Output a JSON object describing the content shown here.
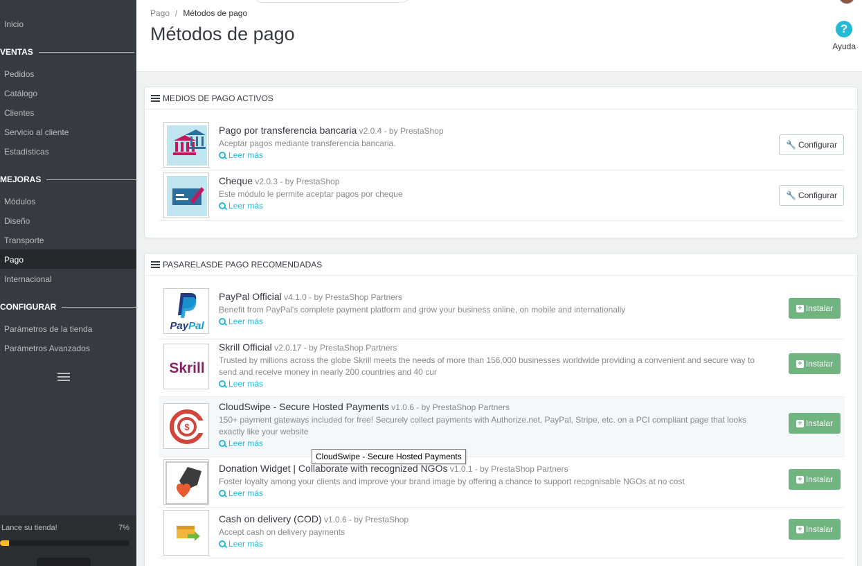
{
  "sidebar": {
    "items": {
      "inicio": "Inicio",
      "pedidos": "Pedidos",
      "catalogo": "Catálogo",
      "clientes": "Clientes",
      "servicio": "Servicio al cliente",
      "estadisticas": "Estadísticas",
      "modulos": "Módulos",
      "diseno": "Diseño",
      "transporte": "Transporte",
      "pago": "Pago",
      "internacional": "Internacional",
      "parametros_tienda": "Parámetros de la tienda",
      "parametros_avanzados": "Parámetros Avanzados"
    },
    "sections": {
      "ventas": "VENTAS",
      "mejoras": "MEJORAS",
      "configurar": "CONFIGURAR"
    },
    "launch": {
      "label": "Lance su tienda!",
      "percent_text": "7%",
      "progress": 0.07
    }
  },
  "header": {
    "breadcrumb": {
      "parent": "Pago",
      "separator": "/",
      "current": "Métodos de pago"
    },
    "title": "Métodos de pago",
    "help_label": "Ayuda",
    "help_icon": "?"
  },
  "active_panel": {
    "heading": "MEDIOS DE PAGO ACTIVOS",
    "modules": [
      {
        "name": "Pago por transferencia bancaria",
        "meta": "v2.0.4 - by PrestaShop",
        "desc": "Aceptar pagos mediante transferencia bancaria.",
        "more": "Leer más",
        "button": "Configurar"
      },
      {
        "name": "Cheque",
        "meta": "v2.0.3 - by PrestaShop",
        "desc": "Este módulo le permite aceptar pagos por cheque",
        "more": "Leer más",
        "button": "Configurar"
      }
    ]
  },
  "recommended_panel": {
    "heading": "PASARELASDE PAGO RECOMENDADAS",
    "modules": [
      {
        "name": "PayPal Official",
        "meta": "v4.1.0 - by PrestaShop Partners",
        "desc": "Benefit from PayPal's complete payment platform and grow your business online, on mobile and internationally",
        "more": "Leer más",
        "button": "Instalar",
        "logo_text": "PayPal"
      },
      {
        "name": "Skrill Official",
        "meta": "v2.0.17 - by PrestaShop Partners",
        "desc": "Trusted by millions across the globe Skrill meets the needs of more than 156,000 businesses worldwide providing a convenient and secure way to send and receive money in nearly 200 countries and 40 cur",
        "more": "Leer más",
        "button": "Instalar",
        "logo_text": "Skrill"
      },
      {
        "name": "CloudSwipe - Secure Hosted Payments",
        "meta": "v1.0.6 - by PrestaShop Partners",
        "desc": "150+ payment gateways included for free! Securely collect payments with Authorize.net, PayPal, Stripe, etc. on a PCI compliant page that looks exactly like your website",
        "more": "Leer más",
        "button": "Instalar"
      },
      {
        "name": "Donation Widget | Collaborate with recognized NGOs",
        "meta": "v1.0.1 - by PrestaShop Partners",
        "desc": "Foster loyalty among your clients and improve your brand image by offering a chance to support recognisable NGOs at no cost",
        "more": "Leer más",
        "button": "Instalar"
      },
      {
        "name": "Cash on delivery (COD)",
        "meta": "v1.0.6 - by PrestaShop",
        "desc": "Accept cash on delivery payments",
        "more": "Leer más",
        "button": "Instalar"
      }
    ]
  },
  "tooltip": "CloudSwipe - Secure Hosted Payments",
  "colors": {
    "accent": "#25b9d7",
    "install": "#70b580",
    "sidebar": "#363a41"
  }
}
